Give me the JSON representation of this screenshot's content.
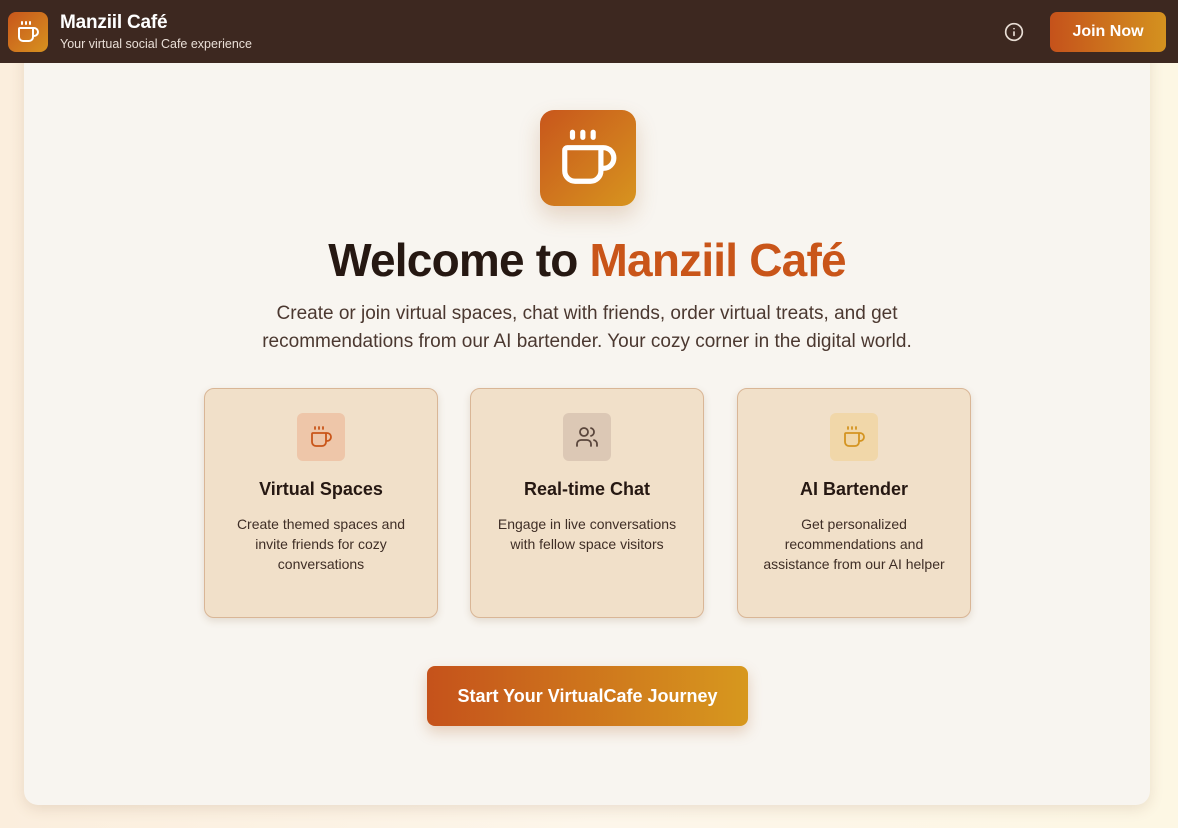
{
  "header": {
    "title": "Manziil Café",
    "subtitle": "Your virtual social Cafe experience",
    "logo_icon": "coffee-cup-icon",
    "info_icon": "info-icon",
    "join_label": "Join Now"
  },
  "hero": {
    "icon": "coffee-cup-icon",
    "welcome_prefix": "Welcome to ",
    "welcome_accent": "Manziil Café",
    "description": "Create or join virtual spaces, chat with friends, order virtual treats, and get recommendations from our AI bartender. Your cozy corner in the digital world."
  },
  "features": [
    {
      "icon": "coffee-cup-icon",
      "title": "Virtual Spaces",
      "description": "Create themed spaces and invite friends for cozy conversations"
    },
    {
      "icon": "users-icon",
      "title": "Real-time Chat",
      "description": "Engage in live conversations with fellow space visitors"
    },
    {
      "icon": "coffee-cup-icon",
      "title": "AI Bartender",
      "description": "Get personalized recommendations and assistance from our AI helper"
    }
  ],
  "cta": {
    "label": "Start Your VirtualCafe Journey"
  },
  "colors": {
    "header_bg": "#3d2820",
    "accent": "#c95519",
    "gradient_start": "#c5521b",
    "gradient_end": "#d7981e",
    "card_bg": "#f1e0c9"
  }
}
